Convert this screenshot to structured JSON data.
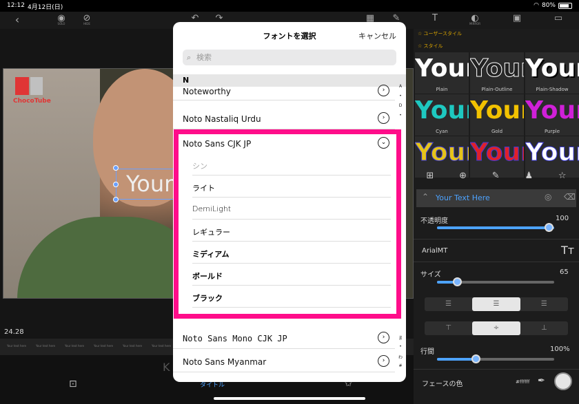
{
  "status": {
    "time": "12:12",
    "date": "4月12日(日)",
    "battery": "80%",
    "battery_level": 0.8
  },
  "toolbar": {
    "solo_label": "SOLO",
    "hide_label": "HIDE",
    "mirror_label": "MIRROR"
  },
  "canvas": {
    "logo_text": "ChocoTube",
    "overlay_text": "Your",
    "timecode": "24.28",
    "timeline_segments": [
      "Your text here",
      "Your text here",
      "Your text here",
      "Your text here",
      "Your text here",
      "Your text here",
      "Your text here",
      "Your text here",
      "Your text here",
      "Your text here",
      "Your text here",
      "Your text here"
    ],
    "bottom_tab": "タイトル"
  },
  "panel": {
    "user_styles_label": "ユーザースタイル",
    "styles_label": "スタイル",
    "style_preview": "Your",
    "styles": [
      {
        "name": "Plain",
        "color": "#ffffff"
      },
      {
        "name": "Plain-Outline",
        "color": "#ffffff"
      },
      {
        "name": "Plain-Shadow",
        "color": "#ffffff"
      },
      {
        "name": "Cyan",
        "color": "#1ec8c0"
      },
      {
        "name": "Gold",
        "color": "#f2c200"
      },
      {
        "name": "Purple",
        "color": "#d020d8"
      },
      {
        "name": "",
        "color": "#e6c419"
      },
      {
        "name": "",
        "color": "#e0202a"
      },
      {
        "name": "",
        "color": "#ffffff"
      }
    ],
    "text_item_label": "Your Text Here",
    "opacity_label": "不透明度",
    "opacity_value": "100",
    "font_name": "ArialMT",
    "size_label": "サイズ",
    "size_value": "65",
    "line_spacing_label": "行間",
    "line_spacing_value": "100%",
    "face_color_label": "フェースの色",
    "face_color_hex": "#ffffff"
  },
  "modal": {
    "title": "フォントを選択",
    "cancel": "キャンセル",
    "search_placeholder": "検索",
    "section": "N",
    "fonts_top": [
      "Noteworthy",
      "Noto Nastaliq Urdu",
      "Noto Sans CJK JP"
    ],
    "weights": [
      "シン",
      "ライト",
      "DemiLight",
      "レギュラー",
      "ミディアム",
      "ボールド",
      "ブラック"
    ],
    "fonts_bottom": [
      "Noto Sans Mono CJK JP",
      "Noto Sans Myanmar"
    ],
    "index_letters": [
      "A",
      "•",
      "D",
      "•",
      "",
      "",
      "",
      "",
      "",
      "",
      "",
      "",
      "",
      "",
      "",
      "",
      "",
      "",
      "",
      "",
      "",
      "",
      "",
      "",
      "",
      "",
      "ま",
      "•",
      "わ",
      "#"
    ]
  }
}
